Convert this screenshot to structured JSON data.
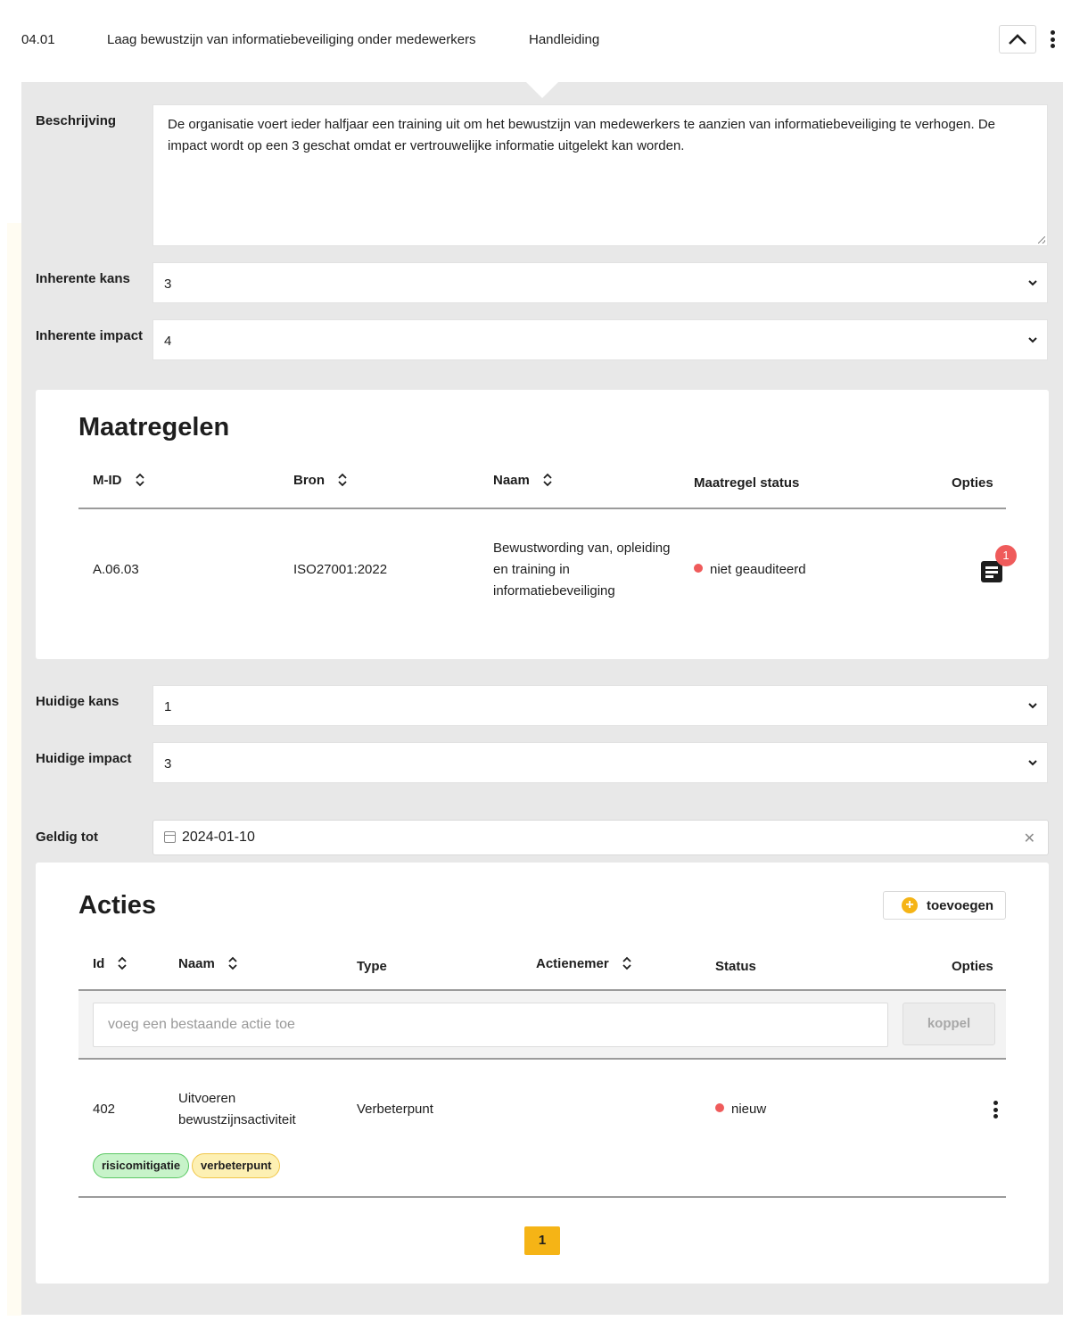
{
  "header": {
    "id": "04.01",
    "title": "Laag bewustzijn van informatiebeveiliging onder medewerkers",
    "link": "Handleiding",
    "collapse_icon": "chevron-up-icon",
    "menu_icon": "kebab-menu-icon"
  },
  "form": {
    "beschrijving_label": "Beschrijving",
    "beschrijving_value": "De organisatie voert ieder halfjaar een training uit om het bewustzijn van medewerkers te aanzien van informatiebeveiliging te verhogen. De impact wordt op een 3 geschat omdat er vertrouwelijke informatie uitgelekt kan worden.",
    "inherente_kans_label": "Inherente kans",
    "inherente_kans_value": "3",
    "inherente_impact_label": "Inherente impact",
    "inherente_impact_value": "4",
    "huidige_kans_label": "Huidige kans",
    "huidige_kans_value": "1",
    "huidige_impact_label": "Huidige impact",
    "huidige_impact_value": "3",
    "geldig_tot_label": "Geldig tot",
    "geldig_tot_value": "2024-01-10"
  },
  "maatregelen": {
    "title": "Maatregelen",
    "columns": [
      "M-ID",
      "Bron",
      "Naam",
      "Maatregel status",
      "Opties"
    ],
    "rows": [
      {
        "mid": "A.06.03",
        "bron": "ISO27001:2022",
        "naam": "Bewustwording van, opleiding en training in informatiebeveiliging",
        "status": "niet geauditeerd",
        "notes_count": "1"
      }
    ]
  },
  "acties": {
    "title": "Acties",
    "add_label": "toevoegen",
    "columns": [
      "Id",
      "Naam",
      "Type",
      "Actienemer",
      "Status",
      "Opties"
    ],
    "existing_placeholder": "voeg een bestaande actie toe",
    "koppel_label": "koppel",
    "rows": [
      {
        "id": "402",
        "naam": "Uitvoeren bewustzijnsactiviteit",
        "type": "Verbeterpunt",
        "actienemer": "",
        "status": "nieuw",
        "tags": [
          "risicomitigatie",
          "verbeterpunt"
        ]
      }
    ],
    "pagination": {
      "current": "1"
    }
  },
  "colors": {
    "accent": "#f5b416",
    "status_red": "#ef5b5b",
    "panel_bg": "#e8e8e8",
    "tag_green": "#c7f3c9",
    "tag_yellow": "#fdf0b3"
  }
}
